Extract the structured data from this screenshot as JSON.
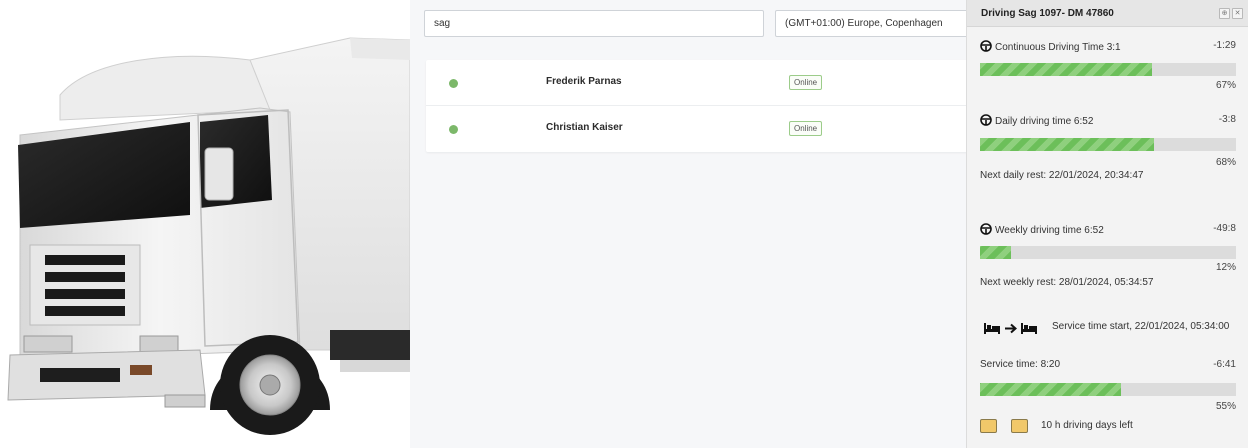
{
  "search": {
    "value": "sag"
  },
  "timezone": {
    "value": "(GMT+01:00) Europe, Copenhagen"
  },
  "drivers": [
    {
      "name": "Frederik Parnas",
      "status": "Online"
    },
    {
      "name": "Christian Kaiser",
      "status": "Online"
    }
  ],
  "panel": {
    "title": "Driving Sag 1097- DM 47860",
    "pin_icon": "pin-icon",
    "close_icon": "close-icon",
    "continuous": {
      "label": "Continuous Driving Time 3:1",
      "delta": "-1:29",
      "progress": 67,
      "percent": "67%"
    },
    "daily": {
      "label": "Daily driving time 6:52",
      "delta": "-3:8",
      "progress": 68,
      "percent": "68%",
      "next": "Next daily rest: 22/01/2024, 20:34:47"
    },
    "weekly": {
      "label": "Weekly driving time 6:52",
      "delta": "-49:8",
      "progress": 12,
      "percent": "12%",
      "next": "Next weekly rest: 28/01/2024, 05:34:57"
    },
    "service": {
      "start": "Service time start, 22/01/2024, 05:34:00",
      "label": "Service time: 8:20",
      "delta": "-6:41",
      "progress": 55,
      "percent": "55%"
    },
    "days_left": "10 h driving days left"
  },
  "colors": {
    "online": "#7cb86a",
    "progress": "#6cbf5a",
    "day_box": "#f1c86a"
  }
}
